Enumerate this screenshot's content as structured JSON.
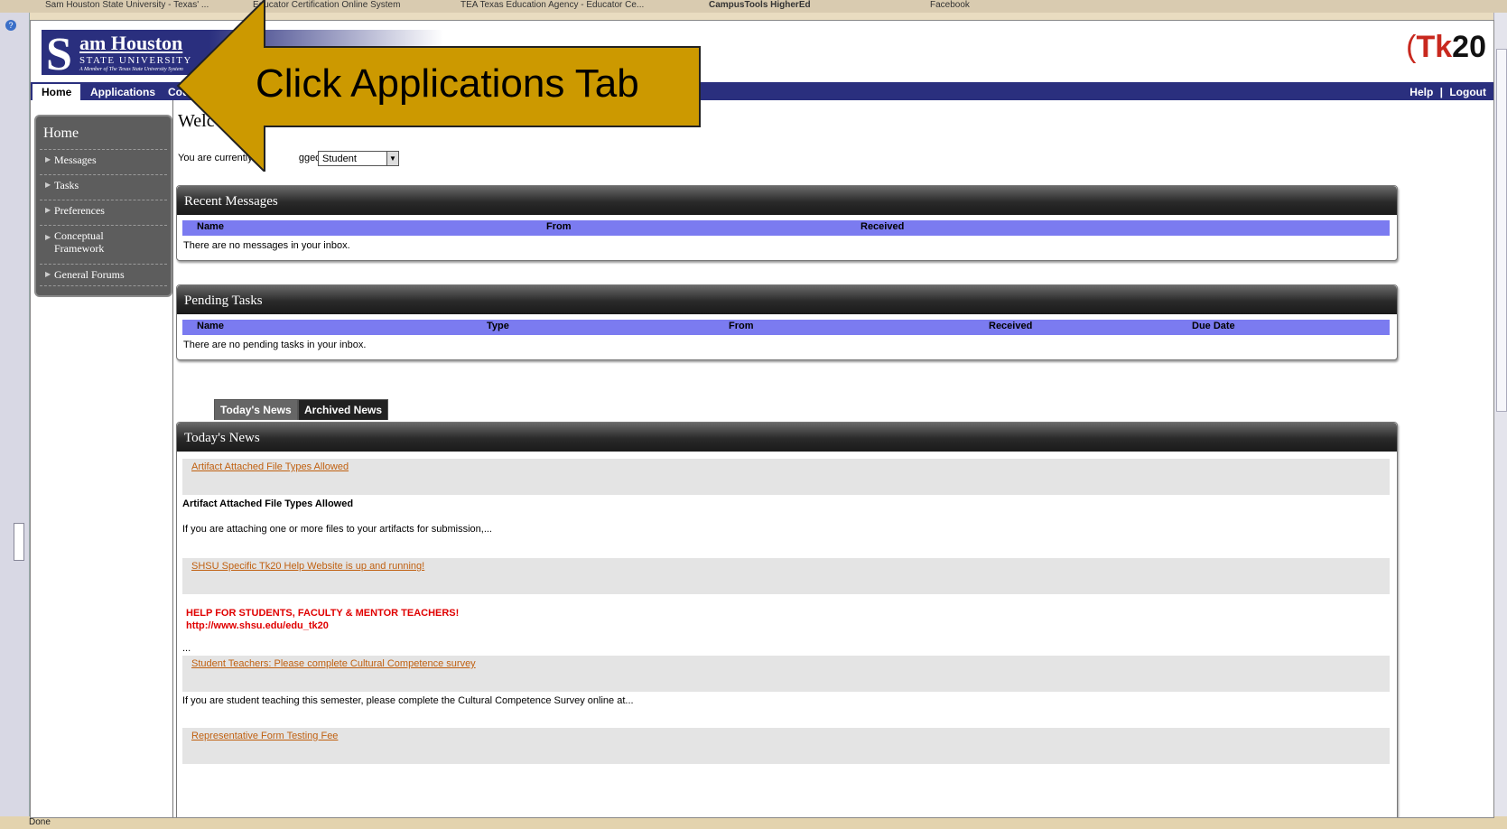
{
  "browser": {
    "tabs": [
      "Sam Houston State University - Texas' ...",
      "Educator Certification Online System",
      "TEA Texas Education Agency - Educator Ce...",
      "CampusTools HigherEd",
      "Facebook"
    ],
    "status": "Done"
  },
  "header": {
    "logo_initial": "S",
    "logo_line1": "am Houston",
    "logo_line2": "STATE UNIVERSITY",
    "logo_line3": "A Member of The Texas State University System",
    "brand_tk": "Tk",
    "brand_20": "20"
  },
  "nav": {
    "tabs": [
      "Home",
      "Applications",
      "Cou"
    ],
    "help": "Help",
    "separator": "|",
    "logout": "Logout"
  },
  "sidebar": {
    "title": "Home",
    "items": [
      "Messages",
      "Tasks",
      "Preferences",
      "Conceptual Framework",
      "General Forums"
    ]
  },
  "main": {
    "welcome": "Welc",
    "login_prefix": "You are currently",
    "login_suffix": "gged in as",
    "role": "Student"
  },
  "messages_panel": {
    "title": "Recent Messages",
    "columns": [
      "Name",
      "From",
      "Received"
    ],
    "empty": "There are no messages in your inbox."
  },
  "tasks_panel": {
    "title": "Pending Tasks",
    "columns": [
      "Name",
      "Type",
      "From",
      "Received",
      "Due Date"
    ],
    "empty": "There are no pending tasks in your inbox."
  },
  "news": {
    "tabs": [
      "Today's News",
      "Archived News"
    ],
    "title": "Today's News",
    "item1_link": "Artifact Attached File Types Allowed",
    "item1_heading": "Artifact Attached File Types Allowed",
    "item1_text": "If you are attaching one or more files to your artifacts for submission,...",
    "item2_link": "SHSU Specific Tk20 Help Website is up and running!",
    "item2_alert1": "HELP FOR STUDENTS, FACULTY & MENTOR TEACHERS!",
    "item2_alert2": "http://www.shsu.edu/edu_tk20",
    "item2_ellipsis": "...",
    "item3_link": "Student Teachers: Please complete Cultural Competence survey",
    "item3_text": "If you are student teaching this semester, please complete the Cultural Competence Survey online at...",
    "item4_link": "Representative Form Testing Fee"
  },
  "callout": {
    "text": "Click Applications Tab",
    "color": "#cc9900"
  }
}
